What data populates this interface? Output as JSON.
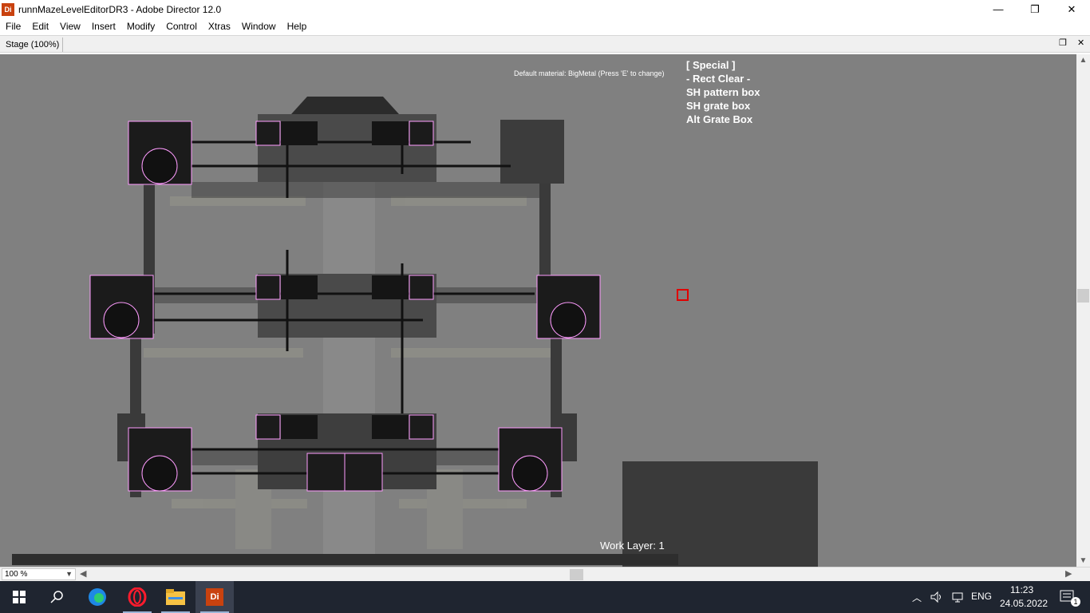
{
  "window": {
    "app_icon_text": "Di",
    "title": "runnMazeLevelEditorDR3 - Adobe Director 12.0",
    "minimize": "—",
    "restore": "❐",
    "close": "✕"
  },
  "menu": {
    "items": [
      "File",
      "Edit",
      "View",
      "Insert",
      "Modify",
      "Control",
      "Xtras",
      "Window",
      "Help"
    ]
  },
  "stage_panel": {
    "tab_label": "Stage (100%)",
    "panel_restore": "❐",
    "panel_close": "✕"
  },
  "stage": {
    "default_material": "Default material: BigMetal (Press 'E' to change)",
    "special_items": [
      "[ Special ]",
      "- Rect Clear -",
      "SH pattern box",
      "SH grate box",
      "Alt Grate Box"
    ],
    "work_layer": "Work Layer: 1"
  },
  "bottom": {
    "zoom": "100 %"
  },
  "taskbar": {
    "app_di_label": "Di",
    "language": "ENG",
    "time": "11:23",
    "date": "24.05.2022",
    "notification_count": "1"
  }
}
